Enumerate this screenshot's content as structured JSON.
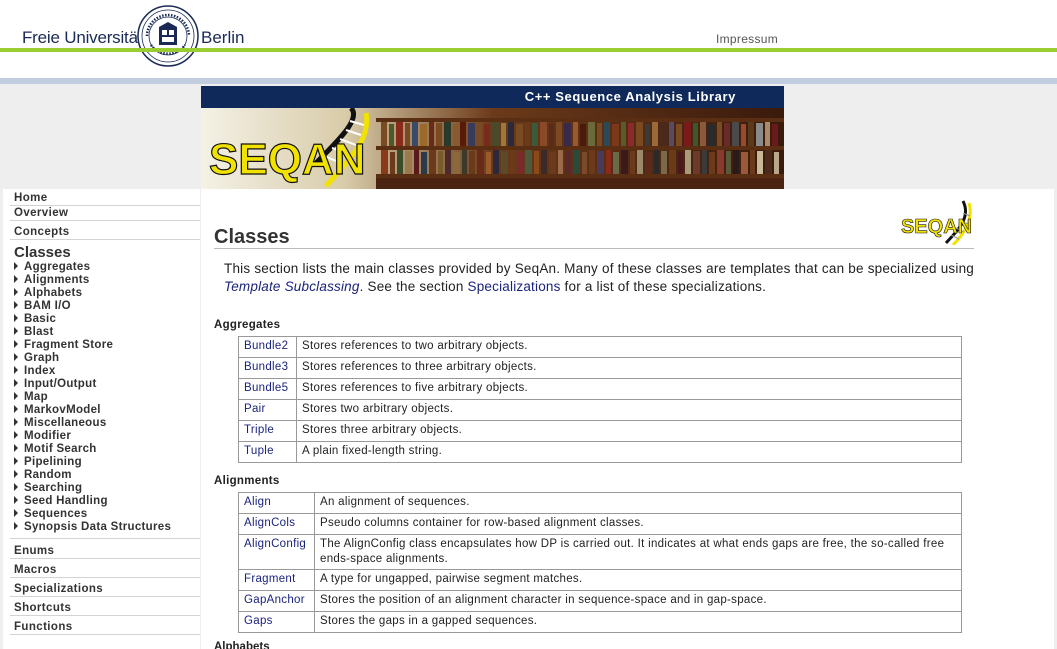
{
  "header": {
    "university_left": "Freie Universität",
    "university_right": "Berlin",
    "impressum_label": "Impressum"
  },
  "banner": {
    "title": "C++ Sequence Analysis Library",
    "logo_text": "SEQAN"
  },
  "sidebar": {
    "top_items": [
      {
        "label": "Home"
      },
      {
        "label": "Overview"
      },
      {
        "label": "Concepts"
      }
    ],
    "classes_title": "Classes",
    "class_items": [
      {
        "label": "Aggregates"
      },
      {
        "label": "Alignments"
      },
      {
        "label": "Alphabets"
      },
      {
        "label": "BAM I/O"
      },
      {
        "label": "Basic"
      },
      {
        "label": "Blast"
      },
      {
        "label": "Fragment Store"
      },
      {
        "label": "Graph"
      },
      {
        "label": "Index"
      },
      {
        "label": "Input/Output"
      },
      {
        "label": "Map"
      },
      {
        "label": "MarkovModel"
      },
      {
        "label": "Miscellaneous"
      },
      {
        "label": "Modifier"
      },
      {
        "label": "Motif Search"
      },
      {
        "label": "Pipelining"
      },
      {
        "label": "Random"
      },
      {
        "label": "Searching"
      },
      {
        "label": "Seed Handling"
      },
      {
        "label": "Sequences"
      },
      {
        "label": "Synopsis Data Structures"
      }
    ],
    "bottom_items": [
      {
        "label": "Enums"
      },
      {
        "label": "Macros"
      },
      {
        "label": "Specializations"
      },
      {
        "label": "Shortcuts"
      },
      {
        "label": "Functions"
      }
    ]
  },
  "main": {
    "title": "Classes",
    "intro": {
      "part1": "This section lists the main classes provided by SeqAn. Many of these classes are templates that can be specialized using ",
      "link1": "Template Subclassing",
      "part2": ". See the section ",
      "link2": "Specializations",
      "part3": " for a list of these specializations."
    },
    "sections": [
      {
        "heading": "Aggregates",
        "rows": [
          {
            "name": "Bundle2",
            "desc": "Stores references to two arbitrary objects."
          },
          {
            "name": "Bundle3",
            "desc": "Stores references to three arbitrary objects."
          },
          {
            "name": "Bundle5",
            "desc": "Stores references to five arbitrary objects."
          },
          {
            "name": "Pair",
            "desc": "Stores two arbitrary objects."
          },
          {
            "name": "Triple",
            "desc": "Stores three arbitrary objects."
          },
          {
            "name": "Tuple",
            "desc": "A plain fixed-length string."
          }
        ]
      },
      {
        "heading": "Alignments",
        "rows": [
          {
            "name": "Align",
            "desc": "An alignment of sequences."
          },
          {
            "name": "AlignCols",
            "desc": "Pseudo columns container for row-based alignment classes."
          },
          {
            "name": "AlignConfig",
            "desc": "The AlignConfig class encapsulates how DP is carried out. It indicates at what ends gaps are free, the so-called free ends-space alignments."
          },
          {
            "name": "Fragment",
            "desc": "A type for ungapped, pairwise segment matches."
          },
          {
            "name": "GapAnchor",
            "desc": "Stores the position of an alignment character in sequence-space and in gap-space."
          },
          {
            "name": "Gaps",
            "desc": "Stores the gaps in a gapped sequences."
          }
        ]
      }
    ],
    "next_heading": "Alphabets"
  },
  "colors": {
    "fu_blue": "#1a2a55",
    "green_line": "#9acd32",
    "banner_blue": "#0f2a5a",
    "link_blue": "#1a237e",
    "logo_yellow": "#f2e200"
  }
}
